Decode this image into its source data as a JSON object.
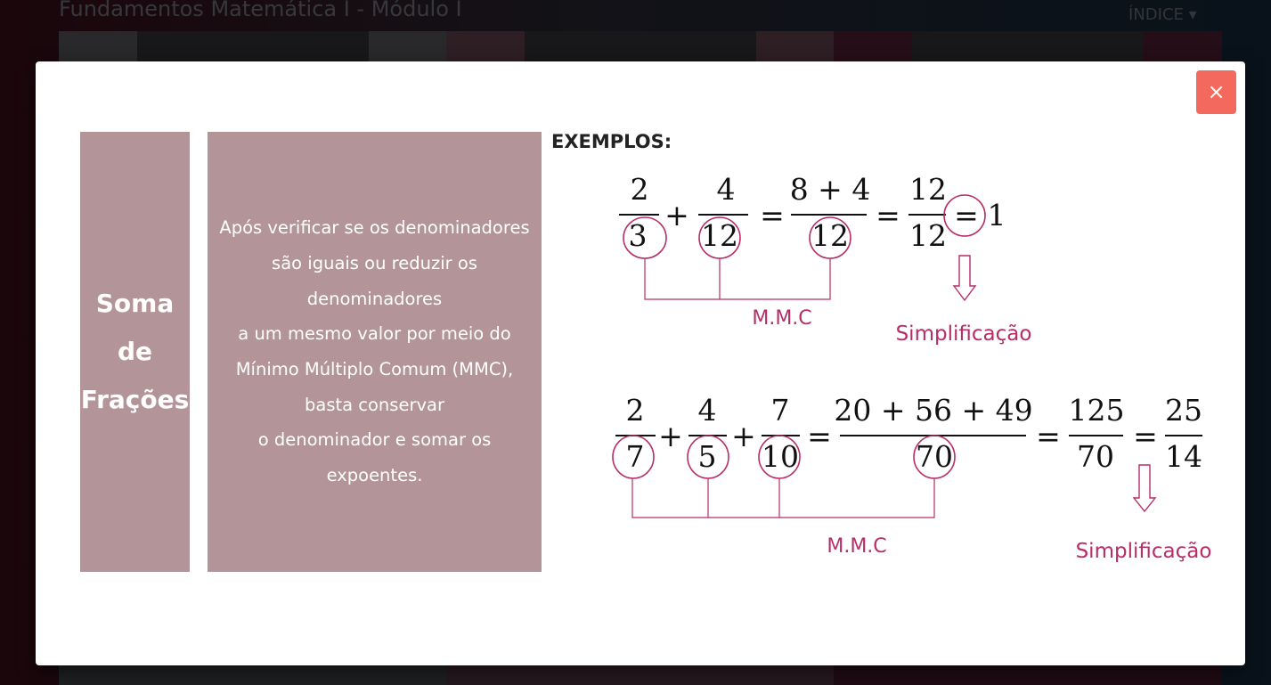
{
  "page": {
    "title": "Fundamentos Matemática I - Módulo I",
    "index_menu": "ÍNDICE"
  },
  "modal": {
    "close_label": "×",
    "topic_title": [
      "Soma",
      "de",
      "Frações"
    ],
    "description_lines": [
      "Após verificar se os denominadores",
      "são iguais ou reduzir os",
      "denominadores",
      "a um mesmo valor por meio do",
      "Mínimo Múltiplo Comum (MMC),",
      "basta conservar",
      "o denominador e somar os",
      "expoentes."
    ],
    "examples_label": "EXEMPLOS:",
    "example1": {
      "f1": {
        "num": "2",
        "den": "3"
      },
      "f2": {
        "num": "4",
        "den": "12"
      },
      "f3": {
        "num": "8 + 4",
        "den": "12"
      },
      "f4": {
        "num": "12",
        "den": "12"
      },
      "result": "1",
      "mmc_label": "M.M.C",
      "simplification_label": "Simplificação"
    },
    "example2": {
      "f1": {
        "num": "2",
        "den": "7"
      },
      "f2": {
        "num": "4",
        "den": "5"
      },
      "f3": {
        "num": "7",
        "den": "10"
      },
      "f4": {
        "num": "20 + 56 + 49",
        "den": "70"
      },
      "f5": {
        "num": "125",
        "den": "70"
      },
      "f6": {
        "num": "25",
        "den": "14"
      },
      "mmc_label": "M.M.C",
      "simplification_label": "Simplificação"
    },
    "operators": {
      "plus": "+",
      "equals": "="
    },
    "accent_color": "#b72d67"
  }
}
